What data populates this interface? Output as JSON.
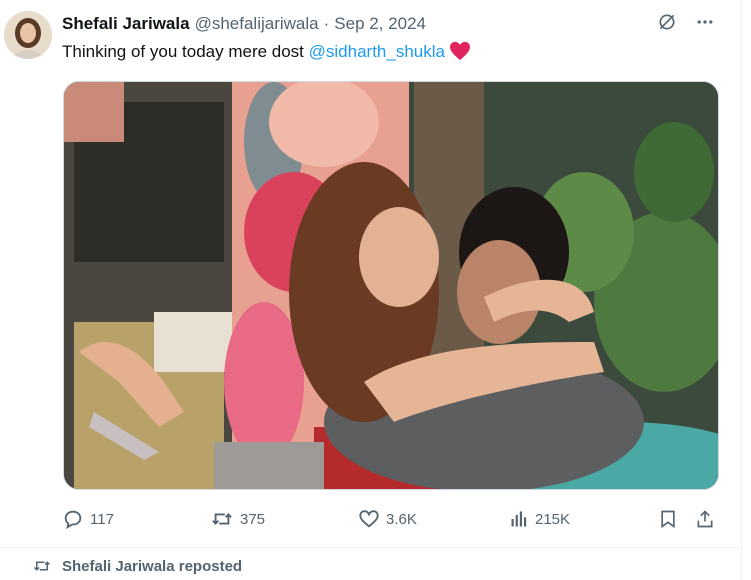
{
  "tweet": {
    "author_name": "Shefali Jariwala",
    "handle": "@shefalijariwala",
    "separator": "·",
    "date": "Sep 2, 2024",
    "text_prefix": "Thinking of you today mere dost ",
    "mention": "@sidharth_shukla",
    "emoji": "red-heart-emoji"
  },
  "metrics": {
    "replies": "117",
    "reposts": "375",
    "likes": "3.6K",
    "views": "215K"
  },
  "icons": {
    "grok": "grok-icon",
    "more": "more-icon",
    "reply": "reply-icon",
    "repost": "repost-icon",
    "like": "like-icon",
    "views": "views-icon",
    "bookmark": "bookmark-icon",
    "share": "share-icon"
  },
  "colors": {
    "text": "#0f1419",
    "secondary": "#536471",
    "link": "#1d9bf0",
    "heart": "#e0245e"
  },
  "next_item": {
    "repost_label": "Shefali Jariwala reposted"
  }
}
